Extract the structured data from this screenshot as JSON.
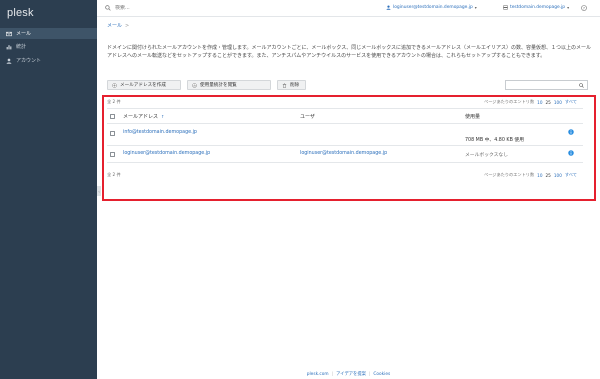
{
  "app": {
    "logo": "plesk"
  },
  "sidebar": {
    "items": [
      {
        "label": "メール",
        "icon": "mail-icon",
        "active": true
      },
      {
        "label": "統計",
        "icon": "chart-icon",
        "active": false
      },
      {
        "label": "アカウント",
        "icon": "user-icon",
        "active": false
      }
    ]
  },
  "topbar": {
    "search_placeholder": "検索...",
    "user": "loginuser@testdomain.demopage.jp",
    "subscription": "testdomain.demopage.jp"
  },
  "breadcrumb": {
    "label": "メール",
    "separator": ">"
  },
  "description": "ドメインに関付けられたメールアカウントを作成・管理します。メールアカウントごとに、メールボックス、同じメールボックスに追加できるメールアドレス（メールエイリアス）の数、容量仮想、１つ以上のメールアドレスへのメール転送などをセットアップすることができます。また、アンチスパムやアンチウイルスのサービスを使用できるアカウントの場合は、これらもセットアップすることもできます。",
  "toolbar": {
    "create_label": "メールアドレスを作成",
    "settings_label": "使用量統計を閲覧",
    "delete_label": "削除"
  },
  "list": {
    "count_label": "全 2 件",
    "pager_label": "ページあたりのエントリ数",
    "page_sizes": [
      "10",
      "25",
      "100",
      "すべて"
    ],
    "columns": {
      "address": "メールアドレス",
      "sort_indicator": "↑",
      "user": "ユーザ",
      "usage": "使用量"
    },
    "rows": [
      {
        "address": "info@testdomain.demopage.jp",
        "user": "",
        "usage": "708 MB 中、4.80 KB 使用"
      },
      {
        "address": "loginuser@testdomain.demopage.jp",
        "user": "loginuser@testdomain.demopage.jp",
        "usage": "メールボックスなし"
      }
    ]
  },
  "footer": {
    "link1": "plesk.com",
    "link2": "アイデアを提案",
    "link3": "Cookies"
  },
  "colors": {
    "sidebar_bg": "#2c3e50",
    "accent": "#2a6ebb",
    "highlight_frame": "#e5202e"
  }
}
